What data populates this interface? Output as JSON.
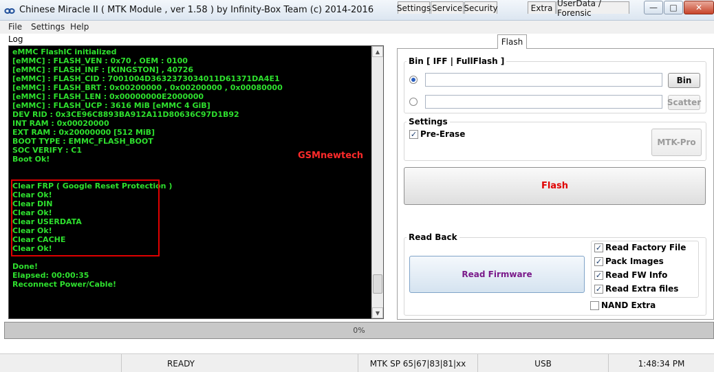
{
  "window": {
    "title": "Chinese Miracle II ( MTK Module , ver 1.58 ) by Infinity-Box Team (c) 2014-2016",
    "app_icon": "infinity-logo-icon",
    "min_label": "—",
    "max_label": "□",
    "close_label": "✕"
  },
  "menu": {
    "file": "File",
    "settings": "Settings",
    "help": "Help"
  },
  "log": {
    "label": "Log",
    "lines": [
      "eMMC FlashIC initialized",
      "[eMMC] : FLASH_VEN : 0x70 , OEM : 0100",
      "[eMMC] : FLASH_INF : [KINGSTON] , 40726",
      "[eMMC] : FLASH_CID : 7001004D3632373034011D61371DA4E1",
      "[eMMC] : FLASH_BRT : 0x00200000 , 0x00200000 , 0x00080000",
      "[eMMC] : FLASH_LEN : 0x00000000E2000000",
      "[eMMC] : FLASH_UCP : 3616 MiB [eMMC 4 GiB]",
      "DEV RID    : 0x3CE96C8893BA912A11D80636C97D1B92",
      "INT RAM    : 0x00020000",
      "EXT RAM    : 0x20000000 [512 MiB]",
      "BOOT TYPE : EMMC_FLASH_BOOT",
      "SOC VERIFY : C1",
      "Boot Ok!",
      "",
      "",
      "Clear FRP ( Google Reset Protection )",
      "Clear Ok!",
      "Clear DIN",
      "Clear Ok!",
      "Clear USERDATA",
      "Clear Ok!",
      "Clear CACHE",
      "Clear Ok!",
      "",
      "Done!",
      "Elapsed: 00:00:35",
      "Reconnect Power/Cable!"
    ],
    "watermark": "GSMnewtech"
  },
  "tabs": [
    {
      "label": "Settings"
    },
    {
      "label": "Service"
    },
    {
      "label": "Security"
    },
    {
      "label": "Flash"
    },
    {
      "label": "Extra"
    },
    {
      "label": "UserData / Forensic"
    }
  ],
  "flash": {
    "bin_group_title": "Bin  [ IFF | FullFlash ]",
    "bin_button": "Bin",
    "scatter_button": "Scatter",
    "bin_path": "",
    "scatter_path": "",
    "settings_title": "Settings",
    "pre_erase_label": "Pre-Erase",
    "pre_erase_checked": "✓",
    "mtk_pro_button": "MTK-Pro",
    "flash_button": "Flash",
    "flash_button_color": "#e00000",
    "readback_title": "Read Back",
    "read_firmware_button": "Read Firmware",
    "read_firmware_color": "#7a1a8a",
    "options": [
      {
        "label": "Read Factory File",
        "mark": "✓"
      },
      {
        "label": "Pack Images",
        "mark": "✓"
      },
      {
        "label": "Read FW Info",
        "mark": "✓"
      },
      {
        "label": "Read Extra files",
        "mark": "✓"
      }
    ],
    "nand_extra_label": "NAND Extra",
    "nand_extra_mark": ""
  },
  "progress": {
    "text": "0%",
    "fraction": 0
  },
  "status": {
    "state": "READY",
    "mtk_sp": "MTK SP 65|67|83|81|xx",
    "port": "USB",
    "time": "1:48:34 PM"
  }
}
